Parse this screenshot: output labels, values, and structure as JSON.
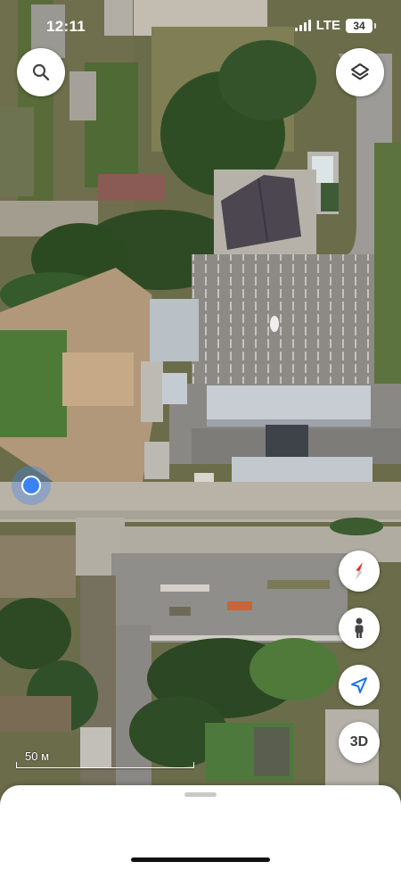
{
  "status_bar": {
    "time": "12:11",
    "network": "LTE",
    "battery_level": "34"
  },
  "map": {
    "type": "satellite",
    "scale_label": "50 м",
    "user_location_visible": true
  },
  "controls": {
    "search_icon": "search-icon",
    "layers_icon": "layers-icon",
    "compass_icon": "compass-icon",
    "street_view_icon": "pegman-icon",
    "my_location_icon": "navigation-arrow-icon",
    "view_3d_label": "3D"
  },
  "colors": {
    "location_blue": "#3b82f6",
    "compass_red": "#e0322a",
    "button_bg": "#ffffff"
  }
}
